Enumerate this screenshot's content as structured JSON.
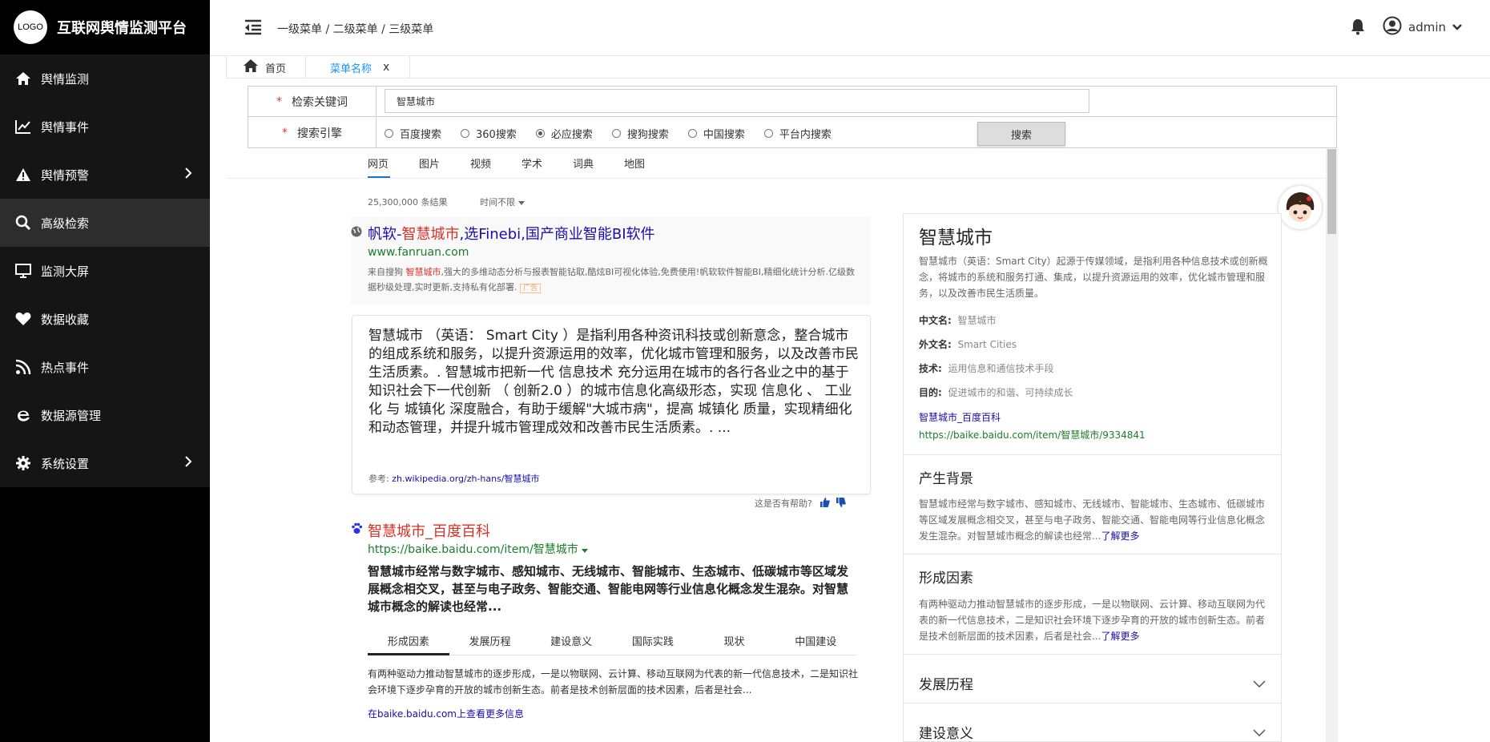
{
  "sidebar": {
    "logo_text": "LOGO",
    "title": "互联网舆情监测平台",
    "items": [
      {
        "label": "舆情监测",
        "icon": "home-icon",
        "arrow": false
      },
      {
        "label": "舆情事件",
        "icon": "line-chart-icon",
        "arrow": false
      },
      {
        "label": "舆情预警",
        "icon": "warning-icon",
        "arrow": true
      },
      {
        "label": "高级检索",
        "icon": "search-icon",
        "arrow": false,
        "active": true
      },
      {
        "label": "监测大屏",
        "icon": "monitor-icon",
        "arrow": false
      },
      {
        "label": "数据收藏",
        "icon": "heart-icon",
        "arrow": false
      },
      {
        "label": "热点事件",
        "icon": "rss-icon",
        "arrow": false
      },
      {
        "label": "数据源管理",
        "icon": "ie-icon",
        "arrow": false
      },
      {
        "label": "系统设置",
        "icon": "gear-icon",
        "arrow": true
      }
    ]
  },
  "header": {
    "breadcrumb": "一级菜单 / 二级菜单 / 三级菜单",
    "username": "admin"
  },
  "tabs": {
    "home": "首页",
    "menu": "菜单名称",
    "close": "x"
  },
  "form": {
    "keyword_label": "检索关键词",
    "keyword_value": "智慧城市",
    "engine_label": "搜索引擎",
    "required_mark": "*",
    "engines": [
      "百度搜索",
      "360搜索",
      "必应搜索",
      "搜狗搜索",
      "中国搜索",
      "平台内搜索"
    ],
    "selected_engine": "必应搜索",
    "search_button": "搜索"
  },
  "results": {
    "vertical_tabs": [
      "网页",
      "图片",
      "视频",
      "学术",
      "词典",
      "地图"
    ],
    "count": "25,300,000 条结果",
    "time_filter": "时间不限",
    "ad": {
      "title_pre": "帆软-",
      "title_hl": "智慧城市",
      "title_post": ",选Finebi,国产商业智能BI软件",
      "url": "www.fanruan.com",
      "desc_pre": "来自搜狗 ",
      "desc_hl": "智慧城市",
      "desc_post": ",强大的多维动态分析与报表智能钻取,酷炫BI可视化体验,免费使用!帆软软件智能BI,精细化统计分析.亿级数据秒级处理,实时更新,支持私有化部署.",
      "tag": "广告"
    },
    "snippet": {
      "text": "智慧城市 （英语： Smart City ）是指利用各种资讯科技或创新意念，整合城市的组成系统和服务，以提升资源运用的效率，优化城市管理和服务，以及改善市民生活质素。. 智慧城市把新一代 信息技术 充分运用在城市的各行各业之中的基于知识社会下一代创新 （ 创新2.0 ）的城市信息化高级形态，实现 信息化 、 工业化 与 城镇化 深度融合，有助于缓解\"大城市病\"，提高 城镇化 质量，实现精细化和动态管理，并提升城市管理成效和改善市民生活质素。. ...",
      "ref_label": "参考:",
      "ref_link": "zh.wikipedia.org/zh-hans/智慧城市",
      "helpful": "这是否有帮助?"
    },
    "baike": {
      "title_hl": "智慧城市",
      "title_post": "_百度百科",
      "url": "https://baike.baidu.com/item/智慧城市",
      "desc": "智慧城市经常与数字城市、感知城市、无线城市、智能城市、生态城市、低碳城市等区域发展概念相交叉，甚至与电子政务、智能交通、智能电网等行业信息化概念发生混杂。对智慧城市概念的解读也经常...",
      "tabs": [
        "形成因素",
        "发展历程",
        "建设意义",
        "国际实践",
        "现状",
        "中国建设"
      ],
      "tab_text": "有两种驱动力推动智慧城市的逐步形成，一是以物联网、云计算、移动互联网为代表的新一代信息技术，二是知识社会环境下逐步孕育的开放的城市创新生态。前者是技术创新层面的技术因素，后者是社会...",
      "more": "在baike.baidu.com上查看更多信息"
    }
  },
  "knowledge": {
    "title": "智慧城市",
    "desc": "智慧城市（英语：Smart City）起源于传媒领域，是指利用各种信息技术或创新概念，将城市的系统和服务打通、集成，以提升资源运用的效率，优化城市管理和服务，以及改善市民生活质量。",
    "facts": [
      {
        "k": "中文名:",
        "v": "智慧城市"
      },
      {
        "k": "外文名:",
        "v": "Smart Cities"
      },
      {
        "k": "技术:",
        "v": "运用信息和通信技术手段"
      },
      {
        "k": "目的:",
        "v": "促进城市的和谐、可持续成长"
      }
    ],
    "link": "智慧城市_百度百科",
    "url": "https://baike.baidu.com/item/智慧城市/9334841",
    "sec1_title": "产生背景",
    "sec1_text": "智慧城市经常与数字城市、感知城市、无线城市、智能城市、生态城市、低碳城市等区域发展概念相交叉，甚至与电子政务、智能交通、智能电网等行业信息化概念发生混杂。对智慧城市概念的解读也经常...",
    "sec2_title": "形成因素",
    "sec2_text": "有两种驱动力推动智慧城市的逐步形成，一是以物联网、云计算、移动互联网为代表的新一代信息技术，二是知识社会环境下逐步孕育的开放的城市创新生态。前者是技术创新层面的技术因素，后者是社会...",
    "more": "了解更多",
    "sec3_title": "发展历程",
    "sec4_title": "建设意义"
  },
  "colors": {
    "sidebar_bg": "#000000",
    "sidebar_active": "#2d2d2d",
    "link_blue": "#1a0dab",
    "url_green": "#1a7e2a",
    "highlight_red": "#d93025",
    "tab_blue": "#1e90ff"
  }
}
